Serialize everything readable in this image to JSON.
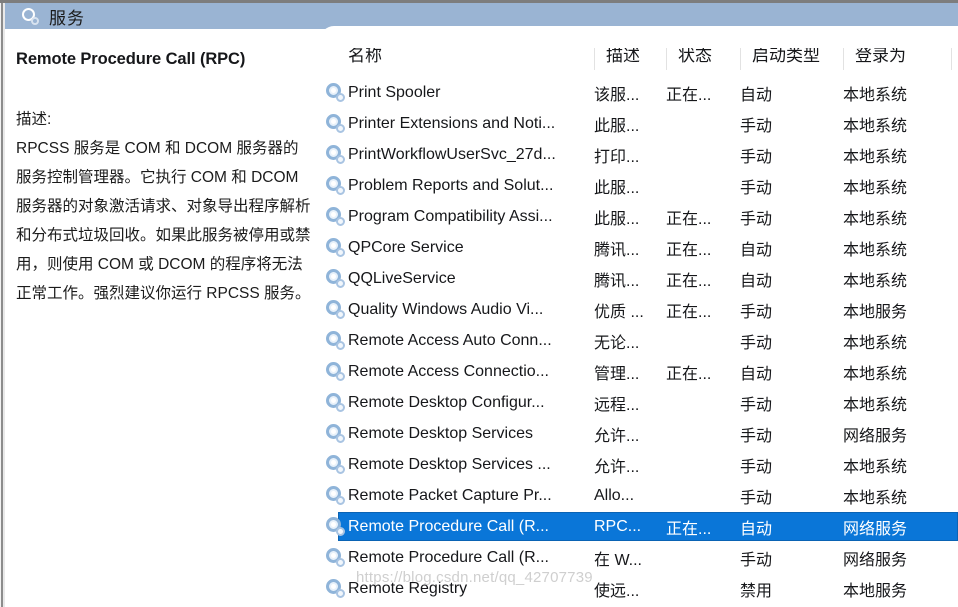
{
  "window": {
    "title": "服务",
    "title_icon": "services-gear-icon",
    "titlebar_color": "#9ab4d3"
  },
  "detail_pane": {
    "service_name": "Remote Procedure Call (RPC)",
    "description_label": "描述:",
    "description_text": "RPCSS 服务是 COM 和 DCOM 服务器的服务控制管理器。它执行 COM 和 DCOM 服务器的对象激活请求、对象导出程序解析和分布式垃圾回收。如果此服务被停用或禁用，则使用 COM 或 DCOM 的程序将无法正常工作。强烈建议你运行 RPCSS 服务。"
  },
  "list": {
    "sort_indicator": "⌃",
    "columns": [
      {
        "key": "name",
        "label": "名称"
      },
      {
        "key": "desc",
        "label": "描述"
      },
      {
        "key": "status",
        "label": "状态"
      },
      {
        "key": "startup",
        "label": "启动类型"
      },
      {
        "key": "logon",
        "label": "登录为"
      }
    ],
    "selected_index": 14,
    "rows": [
      {
        "name": "Print Spooler",
        "desc": "该服...",
        "status": "正在...",
        "startup": "自动",
        "logon": "本地系统"
      },
      {
        "name": "Printer Extensions and Noti...",
        "desc": "此服...",
        "status": "",
        "startup": "手动",
        "logon": "本地系统"
      },
      {
        "name": "PrintWorkflowUserSvc_27d...",
        "desc": "打印...",
        "status": "",
        "startup": "手动",
        "logon": "本地系统"
      },
      {
        "name": "Problem Reports and Solut...",
        "desc": "此服...",
        "status": "",
        "startup": "手动",
        "logon": "本地系统"
      },
      {
        "name": "Program Compatibility Assi...",
        "desc": "此服...",
        "status": "正在...",
        "startup": "手动",
        "logon": "本地系统"
      },
      {
        "name": "QPCore Service",
        "desc": "腾讯...",
        "status": "正在...",
        "startup": "自动",
        "logon": "本地系统"
      },
      {
        "name": "QQLiveService",
        "desc": "腾讯...",
        "status": "正在...",
        "startup": "自动",
        "logon": "本地系统"
      },
      {
        "name": "Quality Windows Audio Vi...",
        "desc": "优质 ...",
        "status": "正在...",
        "startup": "手动",
        "logon": "本地服务"
      },
      {
        "name": "Remote Access Auto Conn...",
        "desc": "无论...",
        "status": "",
        "startup": "手动",
        "logon": "本地系统"
      },
      {
        "name": "Remote Access Connectio...",
        "desc": "管理...",
        "status": "正在...",
        "startup": "自动",
        "logon": "本地系统"
      },
      {
        "name": "Remote Desktop Configur...",
        "desc": "远程...",
        "status": "",
        "startup": "手动",
        "logon": "本地系统"
      },
      {
        "name": "Remote Desktop Services",
        "desc": "允许...",
        "status": "",
        "startup": "手动",
        "logon": "网络服务"
      },
      {
        "name": "Remote Desktop Services ...",
        "desc": "允许...",
        "status": "",
        "startup": "手动",
        "logon": "本地系统"
      },
      {
        "name": "Remote Packet Capture Pr...",
        "desc": "Allo...",
        "status": "",
        "startup": "手动",
        "logon": "本地系统"
      },
      {
        "name": "Remote Procedure Call (R...",
        "desc": "RPC...",
        "status": "正在...",
        "startup": "自动",
        "logon": "网络服务"
      },
      {
        "name": "Remote Procedure Call (R...",
        "desc": "在 W...",
        "status": "",
        "startup": "手动",
        "logon": "网络服务"
      },
      {
        "name": "Remote Registry",
        "desc": "使远...",
        "status": "",
        "startup": "禁用",
        "logon": "本地服务"
      }
    ]
  },
  "watermark": {
    "text": "https://blog.csdn.net/qq_42707739"
  }
}
